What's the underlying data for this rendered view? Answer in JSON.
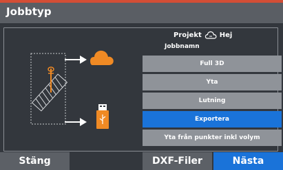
{
  "window": {
    "title": "Jobbtyp"
  },
  "header": {
    "project_label": "Projekt",
    "project_name": "Hej",
    "job_name_label": "Jobbnamn"
  },
  "options": [
    {
      "label": "Full 3D",
      "selected": false
    },
    {
      "label": "Yta",
      "selected": false
    },
    {
      "label": "Lutning",
      "selected": false
    },
    {
      "label": "Exportera",
      "selected": true
    },
    {
      "label": "Yta från punkter inkl volym",
      "selected": false
    }
  ],
  "footer": {
    "close_label": "Stäng",
    "dxf_label": "DXF-Filer",
    "next_label": "Nästa"
  },
  "colors": {
    "accent": "#1a73d9",
    "cloud": "#f08a24",
    "usb": "#f08a24",
    "background_edge": "#d34e36"
  },
  "icons": {
    "cloud": "cloud-icon",
    "cloud_sync": "cloud-sync-icon",
    "usb": "usb-drive-icon",
    "survey_pole": "survey-pole-icon"
  }
}
